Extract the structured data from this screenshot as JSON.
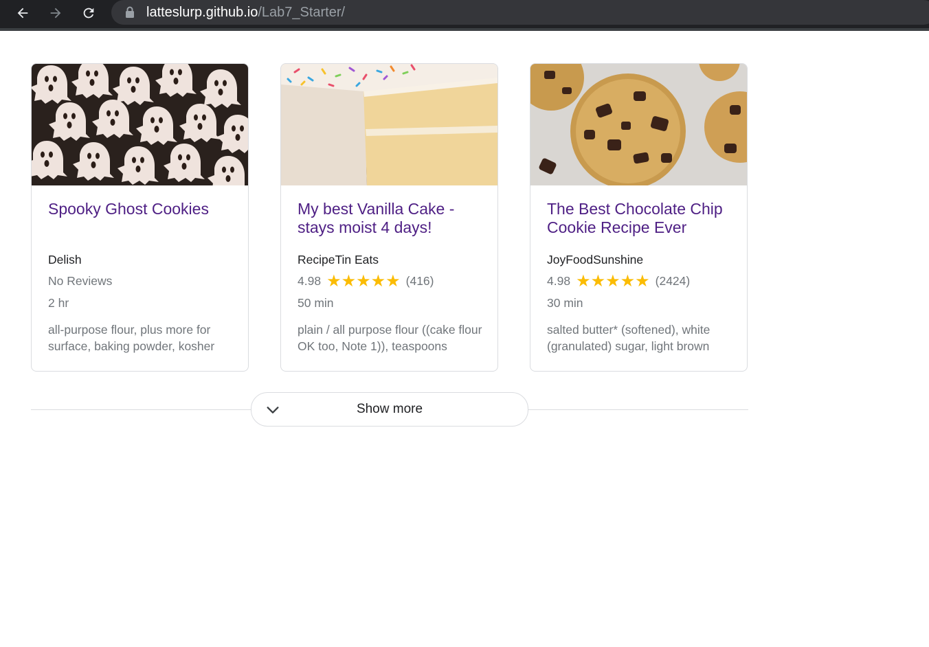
{
  "browser": {
    "url_domain": "latteslurp.github.io",
    "url_path": "/Lab7_Starter/",
    "icons": [
      "back-arrow-icon",
      "forward-arrow-icon",
      "reload-icon",
      "lock-icon"
    ]
  },
  "recipes": [
    {
      "title": "Spooky Ghost Cookies",
      "organization": "Delish",
      "rating_text": "No Reviews",
      "time": "2 hr",
      "ingredients": "all-purpose flour, plus more for surface, baking powder, kosher",
      "image_icon": "ghost-cookies-photo"
    },
    {
      "title": "My best Vanilla Cake - stays moist 4 days!",
      "organization": "RecipeTin Eats",
      "rating_value": "4.98",
      "rating_count": "(416)",
      "stars": 5,
      "time": "50 min",
      "ingredients": "plain / all purpose flour ((cake flour OK too, Note 1)), teaspoons",
      "image_icon": "vanilla-cake-photo"
    },
    {
      "title": "The Best Chocolate Chip Cookie Recipe Ever",
      "organization": "JoyFoodSunshine",
      "rating_value": "4.98",
      "rating_count": "(2424)",
      "stars": 5,
      "time": "30 min",
      "ingredients": "salted butter* (softened), white (granulated) sugar, light brown",
      "image_icon": "chocolate-chip-cookie-photo"
    }
  ],
  "show_more": {
    "label": "Show more",
    "icon": "chevron-down-icon"
  },
  "colors": {
    "title": "#4e1f84",
    "star": "#fbbc04",
    "muted_text": "#70757a",
    "border": "#dadce0",
    "toolbar": "#202124"
  }
}
